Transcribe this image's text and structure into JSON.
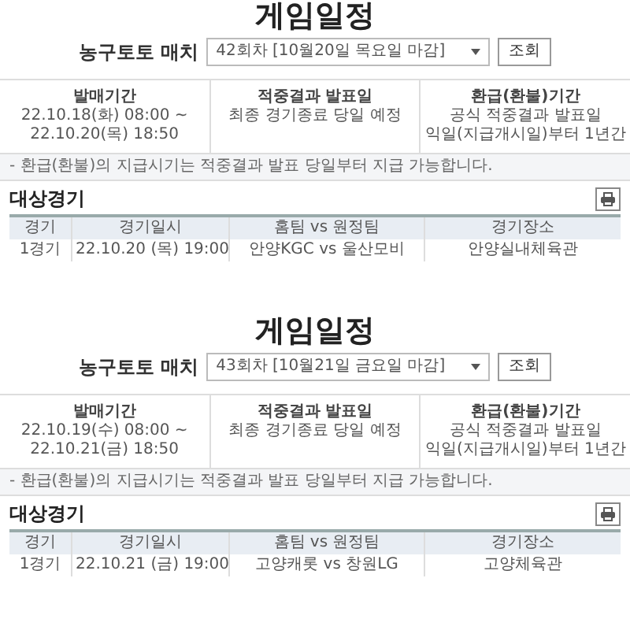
{
  "panels": [
    {
      "title": "게임일정",
      "match_label": "농구토토 매치",
      "round_select": "42회차 [10월20일 목요일 마감]",
      "search_button": "조회",
      "info": [
        {
          "label": "발매기간",
          "lines": [
            "22.10.18(화) 08:00 ~ 22.10.20(목) 18:50"
          ]
        },
        {
          "label": "적중결과 발표일",
          "lines": [
            "최종 경기종료 당일 예정"
          ]
        },
        {
          "label": "환급(환불)기간",
          "lines": [
            "공식 적중결과 발표일",
            "익일(지급개시일)부터 1년간"
          ]
        }
      ],
      "notice": "- 환급(환불)의 지급시기는 적중결과 발표 당일부터 지급 가능합니다.",
      "section_title": "대상경기",
      "columns": [
        "경기",
        "경기일시",
        "홈팀 vs 원정팀",
        "경기장소"
      ],
      "rows": [
        [
          "1경기",
          "22.10.20 (목) 19:00",
          "안양KGC vs 울산모비",
          "안양실내체육관"
        ]
      ]
    },
    {
      "title": "게임일정",
      "match_label": "농구토토 매치",
      "round_select": "43회차 [10월21일 금요일 마감]",
      "search_button": "조회",
      "info": [
        {
          "label": "발매기간",
          "lines": [
            "22.10.19(수) 08:00 ~ 22.10.21(금) 18:50"
          ]
        },
        {
          "label": "적중결과 발표일",
          "lines": [
            "최종 경기종료 당일 예정"
          ]
        },
        {
          "label": "환급(환불)기간",
          "lines": [
            "공식 적중결과 발표일",
            "익일(지급개시일)부터 1년간"
          ]
        }
      ],
      "notice": "- 환급(환불)의 지급시기는 적중결과 발표 당일부터 지급 가능합니다.",
      "section_title": "대상경기",
      "columns": [
        "경기",
        "경기일시",
        "홈팀 vs 원정팀",
        "경기장소"
      ],
      "rows": [
        [
          "1경기",
          "22.10.21 (금) 19:00",
          "고양캐롯 vs 창원LG",
          "고양체육관"
        ]
      ]
    }
  ]
}
